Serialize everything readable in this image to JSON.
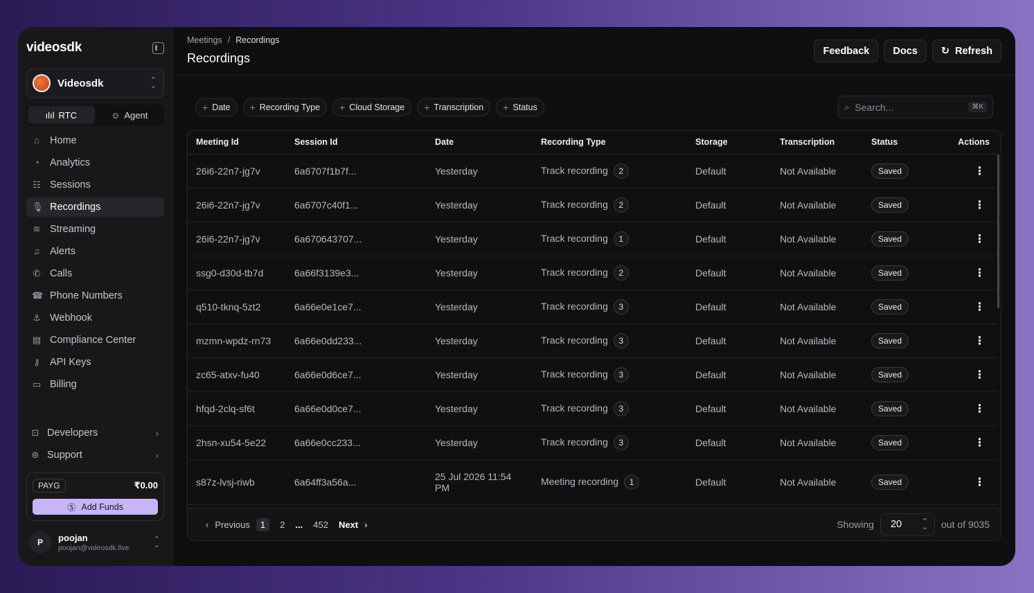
{
  "sidebar": {
    "logo": "videosdk",
    "org": {
      "name": "Videosdk"
    },
    "modes": [
      {
        "label": "RTC",
        "icon": "waveform-icon"
      },
      {
        "label": "Agent",
        "icon": "robot-icon"
      }
    ],
    "items": [
      {
        "label": "Home",
        "icon": "home-icon"
      },
      {
        "label": "Analytics",
        "icon": "pie-chart-icon"
      },
      {
        "label": "Sessions",
        "icon": "list-icon"
      },
      {
        "label": "Recordings",
        "icon": "microphone-icon"
      },
      {
        "label": "Streaming",
        "icon": "broadcast-icon"
      },
      {
        "label": "Alerts",
        "icon": "bell-icon"
      },
      {
        "label": "Calls",
        "icon": "phone-call-icon"
      },
      {
        "label": "Phone Numbers",
        "icon": "phone-icon"
      },
      {
        "label": "Webhook",
        "icon": "webhook-icon"
      },
      {
        "label": "Compliance Center",
        "icon": "document-icon"
      },
      {
        "label": "API Keys",
        "icon": "key-icon"
      },
      {
        "label": "Billing",
        "icon": "credit-card-icon"
      }
    ],
    "bottom_items": [
      {
        "label": "Developers",
        "icon": "code-icon"
      },
      {
        "label": "Support",
        "icon": "lifebuoy-icon"
      }
    ],
    "funds": {
      "plan": "PAYG",
      "balance": "₹0.00",
      "add_label": "Add Funds"
    },
    "user": {
      "initial": "P",
      "name": "poojan",
      "email": "poojan@videosdk.live"
    }
  },
  "header": {
    "breadcrumb": [
      "Meetings",
      "/",
      "Recordings"
    ],
    "title": "Recordings",
    "actions": {
      "feedback": "Feedback",
      "docs": "Docs",
      "refresh": "Refresh"
    }
  },
  "filters": [
    "Date",
    "Recording Type",
    "Cloud Storage",
    "Transcription",
    "Status"
  ],
  "search": {
    "placeholder": "Search...",
    "shortcut": "⌘K"
  },
  "table": {
    "columns": [
      "Meeting Id",
      "Session Id",
      "Date",
      "Recording Type",
      "Storage",
      "Transcription",
      "Status",
      "Actions"
    ],
    "rows": [
      {
        "meeting_id": "26i6-22n7-jg7v",
        "session_id": "6a6707f1b7f...",
        "date": "Yesterday",
        "type": "Track recording",
        "count": "2",
        "storage": "Default",
        "transcription": "Not Available",
        "status": "Saved"
      },
      {
        "meeting_id": "26i6-22n7-jg7v",
        "session_id": "6a6707c40f1...",
        "date": "Yesterday",
        "type": "Track recording",
        "count": "2",
        "storage": "Default",
        "transcription": "Not Available",
        "status": "Saved"
      },
      {
        "meeting_id": "26i6-22n7-jg7v",
        "session_id": "6a670643707...",
        "date": "Yesterday",
        "type": "Track recording",
        "count": "1",
        "storage": "Default",
        "transcription": "Not Available",
        "status": "Saved"
      },
      {
        "meeting_id": "ssg0-d30d-tb7d",
        "session_id": "6a66f3139e3...",
        "date": "Yesterday",
        "type": "Track recording",
        "count": "2",
        "storage": "Default",
        "transcription": "Not Available",
        "status": "Saved"
      },
      {
        "meeting_id": "q510-tknq-5zt2",
        "session_id": "6a66e0e1ce7...",
        "date": "Yesterday",
        "type": "Track recording",
        "count": "3",
        "storage": "Default",
        "transcription": "Not Available",
        "status": "Saved"
      },
      {
        "meeting_id": "mzmn-wpdz-rn73",
        "session_id": "6a66e0dd233...",
        "date": "Yesterday",
        "type": "Track recording",
        "count": "3",
        "storage": "Default",
        "transcription": "Not Available",
        "status": "Saved"
      },
      {
        "meeting_id": "zc65-atxv-fu40",
        "session_id": "6a66e0d6ce7...",
        "date": "Yesterday",
        "type": "Track recording",
        "count": "3",
        "storage": "Default",
        "transcription": "Not Available",
        "status": "Saved"
      },
      {
        "meeting_id": "hfqd-2clq-sf6t",
        "session_id": "6a66e0d0ce7...",
        "date": "Yesterday",
        "type": "Track recording",
        "count": "3",
        "storage": "Default",
        "transcription": "Not Available",
        "status": "Saved"
      },
      {
        "meeting_id": "2hsn-xu54-5e22",
        "session_id": "6a66e0cc233...",
        "date": "Yesterday",
        "type": "Track recording",
        "count": "3",
        "storage": "Default",
        "transcription": "Not Available",
        "status": "Saved"
      },
      {
        "meeting_id": "s87z-lvsj-riwb",
        "session_id": "6a64ff3a56a...",
        "date": "25 Jul 2026 11:54 PM",
        "type": "Meeting recording",
        "count": "1",
        "storage": "Default",
        "transcription": "Not Available",
        "status": "Saved"
      }
    ]
  },
  "pagination": {
    "previous": "Previous",
    "pages": [
      "1",
      "2"
    ],
    "ellipsis": "...",
    "last_page": "452",
    "next": "Next",
    "showing_label": "Showing",
    "page_size": "20",
    "total_label": "out of 9035"
  }
}
